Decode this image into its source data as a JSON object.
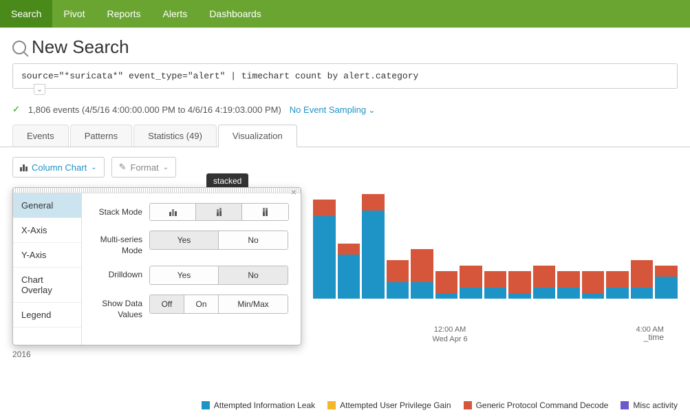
{
  "topnav": [
    "Search",
    "Pivot",
    "Reports",
    "Alerts",
    "Dashboards"
  ],
  "title": "New Search",
  "query": "source=\"*suricata*\" event_type=\"alert\" | timechart count by alert.category",
  "status": {
    "count": "1,806 events",
    "range": "(4/5/16 4:00:00.000 PM to 4/6/16 4:19:03.000 PM)",
    "sampling": "No Event Sampling"
  },
  "tabs": [
    {
      "label": "Events",
      "active": false
    },
    {
      "label": "Patterns",
      "active": false
    },
    {
      "label": "Statistics (49)",
      "active": false
    },
    {
      "label": "Visualization",
      "active": true
    }
  ],
  "toolbar": {
    "chart_type": "Column Chart",
    "format": "Format"
  },
  "panel": {
    "tooltip": "stacked",
    "side": [
      "General",
      "X-Axis",
      "Y-Axis",
      "Chart Overlay",
      "Legend"
    ],
    "rows": {
      "stack": {
        "label": "Stack Mode"
      },
      "multi": {
        "label": "Multi-series Mode",
        "opts": [
          "Yes",
          "No"
        ]
      },
      "drill": {
        "label": "Drilldown",
        "opts": [
          "Yes",
          "No"
        ]
      },
      "datav": {
        "label": "Show Data Values",
        "opts": [
          "Off",
          "On",
          "Min/Max"
        ]
      }
    }
  },
  "chart_data": {
    "type": "bar",
    "ylim": [
      0,
      20
    ],
    "yticks": [
      5,
      10,
      20
    ],
    "xlabel": "_time",
    "year": "2016",
    "series_colors": {
      "Attempted Information Leak": "#1e93c6",
      "Attempted User Privilege Gain": "#f2b827",
      "Generic Protocol Command Decode": "#d6563c",
      "Misc activity": "#6a5acd"
    },
    "xaxis": [
      {
        "pos": 5.5,
        "label": "12:00 AM",
        "sub": "Wed Apr 6"
      },
      {
        "pos": 13.5,
        "label": "4:00 AM",
        "sub": ""
      }
    ],
    "data": [
      {
        "ail": 15,
        "gpc": 3
      },
      {
        "ail": 8,
        "gpc": 2
      },
      {
        "ail": 16,
        "gpc": 3
      },
      {
        "ail": 3,
        "gpc": 4
      },
      {
        "ail": 3,
        "gpc": 6
      },
      {
        "ail": 1,
        "gpc": 4
      },
      {
        "ail": 2,
        "gpc": 4
      },
      {
        "ail": 2,
        "gpc": 3
      },
      {
        "ail": 1,
        "gpc": 4
      },
      {
        "ail": 2,
        "gpc": 4
      },
      {
        "ail": 2,
        "gpc": 3
      },
      {
        "ail": 1,
        "gpc": 4
      },
      {
        "ail": 2,
        "gpc": 3
      },
      {
        "ail": 2,
        "gpc": 5
      },
      {
        "ail": 4,
        "gpc": 2
      }
    ]
  },
  "legend": [
    {
      "label": "Attempted Information Leak",
      "color": "#1e93c6"
    },
    {
      "label": "Attempted User Privilege Gain",
      "color": "#f2b827"
    },
    {
      "label": "Generic Protocol Command Decode",
      "color": "#d6563c"
    },
    {
      "label": "Misc activity",
      "color": "#6a5acd"
    }
  ]
}
